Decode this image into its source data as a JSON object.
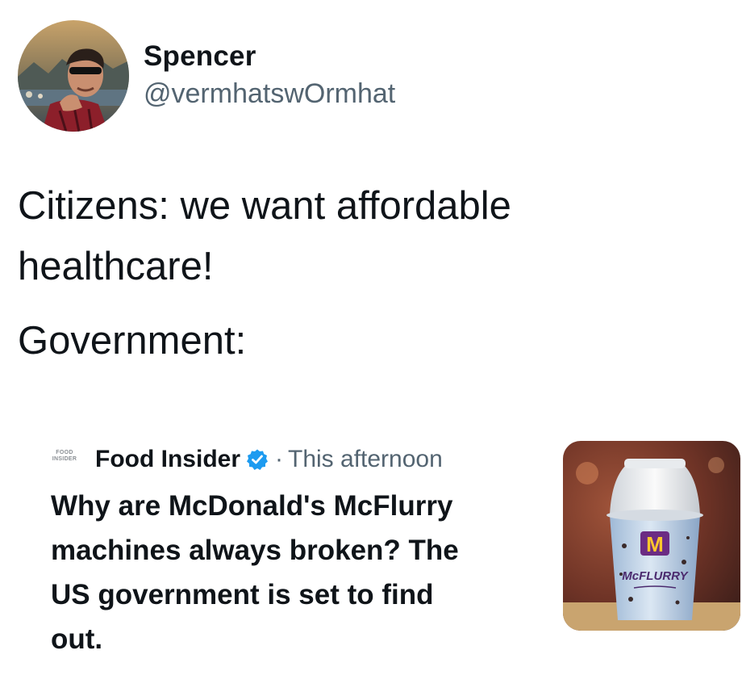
{
  "author": {
    "display_name": "Spencer",
    "handle": "@vermhatswOrmhat",
    "avatar_icon": "profile-photo"
  },
  "tweet": {
    "lines": [
      "Citizens: we want affordable",
      "healthcare!",
      "Government:"
    ]
  },
  "quoted_headline": {
    "logo_text_1": "FOOD",
    "logo_text_2": "INSIDER",
    "source_name": "Food Insider",
    "verified_icon": "verified-badge-icon",
    "separator": "·",
    "time": "This afternoon",
    "lines": [
      "Why are McDonald's McFlurry",
      "machines always broken? The",
      "US government is set to find",
      "out."
    ],
    "thumbnail": {
      "brand_text": "McFLURRY",
      "logo": "M"
    }
  },
  "colors": {
    "text_primary": "#0f1419",
    "text_secondary": "#536471",
    "verified_blue": "#1d9bf0",
    "mcdonalds_purple": "#6b2c83",
    "mcdonalds_gold": "#ffc72c"
  }
}
